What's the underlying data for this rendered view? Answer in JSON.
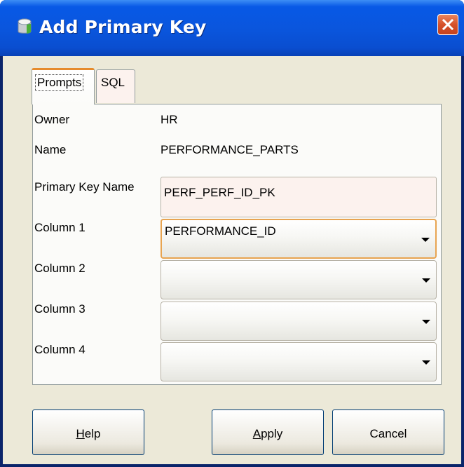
{
  "window": {
    "title": "Add Primary Key",
    "icons": {
      "app": "database-icon",
      "close": "close-icon"
    }
  },
  "tabs": [
    {
      "label": "Prompts",
      "active": true
    },
    {
      "label": "SQL",
      "active": false
    }
  ],
  "form": {
    "owner": {
      "label": "Owner",
      "value": "HR"
    },
    "name": {
      "label": "Name",
      "value": "PERFORMANCE_PARTS"
    },
    "primary_key_name": {
      "label": "Primary Key Name",
      "value": "PERF_PERF_ID_PK"
    },
    "columns": [
      {
        "label": "Column 1",
        "value": "PERFORMANCE_ID"
      },
      {
        "label": "Column 2",
        "value": ""
      },
      {
        "label": "Column 3",
        "value": ""
      },
      {
        "label": "Column 4",
        "value": ""
      }
    ]
  },
  "buttons": {
    "help": {
      "accel": "H",
      "rest": "elp"
    },
    "apply": {
      "accel": "A",
      "rest": "pply"
    },
    "cancel": {
      "label": "Cancel"
    }
  },
  "colors": {
    "title_bar": "#0a55dc",
    "close_button": "#d6512a",
    "dialog_bg": "#ece9d8",
    "focus_outline": "#e8a450"
  }
}
